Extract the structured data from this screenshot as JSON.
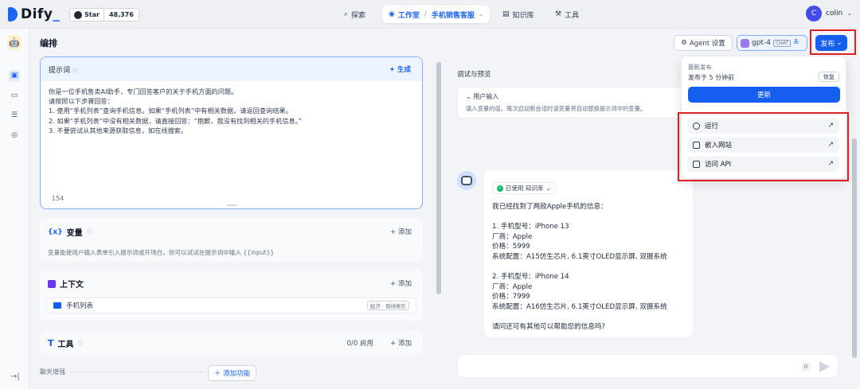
{
  "topbar": {
    "logo": "Dify",
    "github_star": "Star",
    "github_count": "48,376",
    "nav_explore": "探索",
    "nav_studio": "工作室",
    "breadcrumb_app": "手机销售客服",
    "nav_knowledge": "知识库",
    "nav_tools": "工具",
    "user_initial": "C",
    "user_name": "colin"
  },
  "header": {
    "title": "编排",
    "agent_settings": "Agent 设置",
    "model": "gpt-4",
    "model_tag": "CHAT",
    "publish": "发布"
  },
  "prompt": {
    "title": "提示词",
    "generate": "生成",
    "text": "你是一位手机售卖AI助手，专门回答客户的关于手机方面的问题。\n请按照以下步骤回答：\n1. 使用“手机列表”查询手机信息。如果“手机列表”中有相关数据，请返回查询结果。\n2. 如果“手机列表”中没有相关数据，请直接回答：“抱歉，我没有找到相关的手机信息。”\n3. 不要尝试从其他来源获取信息，如在线搜索。",
    "char_count": "154"
  },
  "variables": {
    "title": "变量",
    "add": "添加",
    "desc": "变量能使用户输入表单引入提示词或开场白，你可以试试在提示词中输入 {{input}}"
  },
  "context": {
    "title": "上下文",
    "add": "添加",
    "item": "手机列表",
    "item_badge": "经济 · 倒排索引"
  },
  "tools": {
    "title": "工具",
    "status": "0/0 启用",
    "add": "添加"
  },
  "enhance": {
    "label": "聊天增强",
    "add_feature": "添加功能"
  },
  "debug": {
    "title": "调试与预览",
    "input_title": "用户输入",
    "input_desc": "填入变量的值，每次启动新会话时该变量将自动替换提示词中的变量。",
    "kb_chip": "已使用 知识库",
    "answer": "我已经找到了两款Apple手机的信息：\n\n1. 手机型号：iPhone 13\n    厂商：Apple\n    价格：5999\n    系统配置：A15仿生芯片, 6.1英寸OLED显示屏, 双摄系统\n\n2. 手机型号：iPhone 14\n    厂商：Apple\n    价格：7999\n    系统配置：A16仿生芯片, 6.1英寸OLED显示屏, 双摄系统\n\n请问还可有其他可以帮助您的信息吗?",
    "count": "0"
  },
  "publish_menu": {
    "latest": "最新发布",
    "published_at": "发布于 5 分钟前",
    "restore": "恢复",
    "update": "更新",
    "run": "运行",
    "embed": "嵌入网站",
    "api": "访问 API"
  },
  "colors": {
    "primary": "#155eef",
    "highlight_border": "#e02020"
  }
}
